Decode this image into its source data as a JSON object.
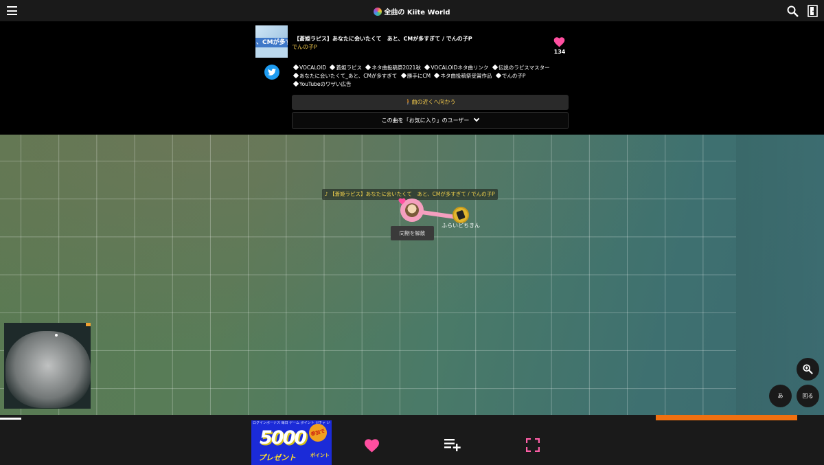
{
  "app": {
    "title": "全曲の Kiite World",
    "icons": {
      "menu": "hamburger-menu-icon",
      "search": "search-icon",
      "exit": "exit-door-icon"
    }
  },
  "song": {
    "title": "【蒼姫ラピス】あなたに会いたくて　あと、CMが多すぎて / でんの子P",
    "thumbnail_text": "、CMが多すぎ",
    "artist": "でんの子P",
    "favorite_count": "134",
    "tags": [
      "VOCALOID",
      "蒼姫ラピス",
      "ネタ曲投稿祭2021秋",
      "VOCALOIDネタ曲リンク",
      "伝説のラピスマスター",
      "あなたに会いたくて_あと、CMが多すぎて",
      "勝手にCM",
      "ネタ曲投稿祭受賞作品",
      "でんの子P",
      "YouTubeのワザい広告"
    ],
    "goto_label": "曲の近くへ向かう",
    "favorite_users_label": "この曲を「お気に入り」のユーザー"
  },
  "map": {
    "song_label": "♪ 【蒼姫ラピス】あなたに会いたくて　あと、CMが多すぎて / でんの子P",
    "other_user_name": "ふらいどちきん",
    "unsync_label": "同期を解散",
    "kana_label": "あ",
    "rotate_label": "回る"
  },
  "progress": {
    "played_fraction": 0.026
  },
  "banner": {
    "small_text": "ログインボーナス 毎日 ゲーム ポイント ガチャ いいログイン 参加で",
    "big_text": "5000",
    "present_text": "プレゼント",
    "point_text": "ポイント",
    "badge_text": "参加で"
  },
  "colors": {
    "accent_pink": "#ff4fa0",
    "accent_yellow": "#f2c94c",
    "progress_orange": "#f07010"
  }
}
